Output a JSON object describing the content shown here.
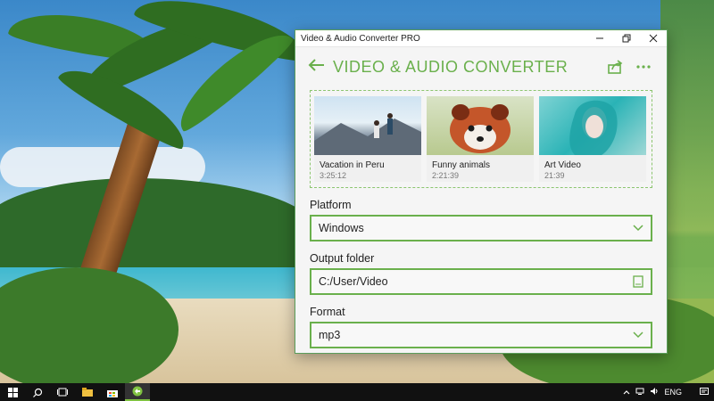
{
  "window": {
    "title": "Video & Audio Converter PRO",
    "controls": {
      "minimize": "minimize-icon",
      "maximize": "restore-icon",
      "close": "close-icon"
    }
  },
  "header": {
    "back_icon": "arrow-left-icon",
    "title": "VIDEO & AUDIO CONVERTER",
    "share_icon": "share-icon",
    "more_icon": "more-icon"
  },
  "media": [
    {
      "title": "Vacation in Peru",
      "duration": "3:25:12"
    },
    {
      "title": "Funny animals",
      "duration": "2:21:39"
    },
    {
      "title": "Art Video",
      "duration": "21:39"
    }
  ],
  "platform": {
    "label": "Platform",
    "value": "Windows"
  },
  "output": {
    "label": "Output folder",
    "value": "C:/User/Video"
  },
  "format": {
    "label": "Format",
    "value": "mp3"
  },
  "taskbar": {
    "language": "ENG",
    "icons": [
      "windows-start-icon",
      "search-icon",
      "task-view-icon",
      "file-explorer-icon",
      "store-icon",
      "app-icon"
    ]
  },
  "colors": {
    "accent": "#6ab04c"
  }
}
